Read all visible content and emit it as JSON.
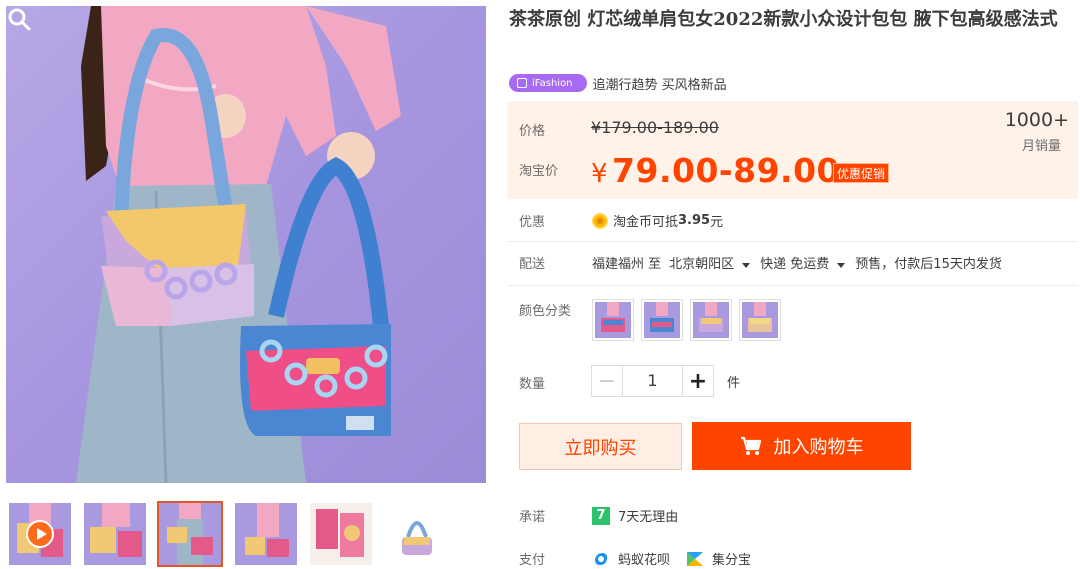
{
  "product": {
    "title": "茶茶原创 灯芯绒单肩包女2022新款小众设计包包 腋下包高级感法式",
    "badge": "iFashion",
    "tagline": "追潮行趋势 买风格新品"
  },
  "price": {
    "orig_label": "价格",
    "orig_value": "¥179.00-189.00",
    "tb_label": "淘宝价",
    "tb_currency": "¥",
    "tb_value": "79.00-89.00",
    "promo": "优惠促销",
    "sales_count": "1000+",
    "sales_label": "月销量"
  },
  "discount": {
    "label": "优惠",
    "text": "淘金币可抵",
    "amount": "3.95",
    "unit": "元"
  },
  "delivery": {
    "label": "配送",
    "from": "福建福州 至",
    "to": "北京朝阳区",
    "method": "快递 免运费",
    "note": "预售，付款后15天内发货"
  },
  "color": {
    "label": "颜色分类",
    "options": [
      "swatch-1",
      "swatch-2",
      "swatch-3",
      "swatch-4"
    ]
  },
  "quantity": {
    "label": "数量",
    "minus": "−",
    "value": "1",
    "plus": "+",
    "unit": "件"
  },
  "actions": {
    "buy_now": "立即购买",
    "add_cart": "加入购物车"
  },
  "promise": {
    "label": "承诺",
    "badge": "7",
    "text": "7天无理由"
  },
  "payment": {
    "label": "支付",
    "methods": [
      "蚂蚁花呗",
      "集分宝"
    ]
  },
  "colors": {
    "accent": "#ff4400",
    "price_bg": "#fff2e8",
    "ifashion": "#a86af0",
    "promise_green": "#2dc36a"
  },
  "icons": {
    "zoom": "magnifier-icon",
    "play": "play-icon",
    "cart": "cart-icon",
    "coin": "coin-icon",
    "huabei": "huabei-icon",
    "jifenbao": "jifenbao-icon"
  }
}
